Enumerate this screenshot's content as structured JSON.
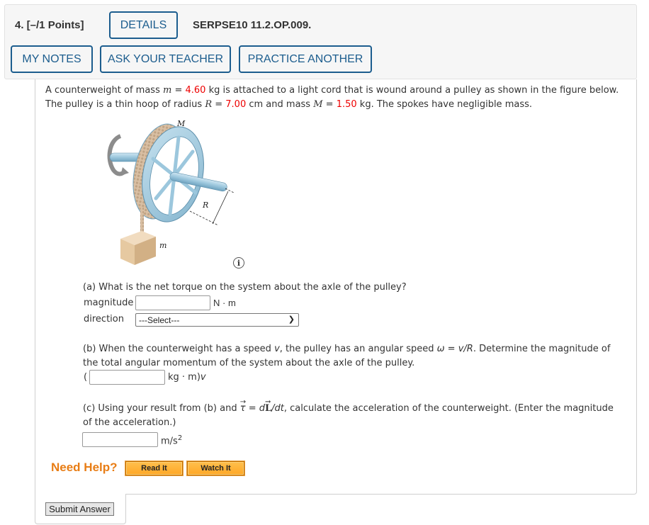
{
  "header": {
    "question_title": "4.  [–/1 Points]",
    "details_label": "DETAILS",
    "question_code": "SERPSE10 11.2.OP.009.",
    "my_notes_label": "MY NOTES",
    "ask_teacher_label": "ASK YOUR TEACHER",
    "practice_another_label": "PRACTICE ANOTHER"
  },
  "problem": {
    "line1_a": "A counterweight of mass ",
    "line1_var_m": "m",
    "line1_eq": " = ",
    "mass_m": "4.60",
    "line1_b": " kg is attached to a light cord that is wound around a pulley as shown in the figure below.",
    "line2_a": "The pulley is a thin hoop of radius ",
    "line2_var_R": "R",
    "line2_eq": " = ",
    "radius_R": "7.00",
    "line2_b": " cm and mass ",
    "line2_var_M": "M",
    "line2_eq2": " = ",
    "mass_M": "1.50",
    "line2_c": " kg. The spokes have negligible mass.",
    "value_color": "#ee0000"
  },
  "figure": {
    "label_M": "M",
    "label_R": "R",
    "label_m": "m",
    "info_icon": "info-icon",
    "info_glyph": "i"
  },
  "part_a": {
    "question": "(a) What is the net torque on the system about the axle of the pulley?",
    "magnitude_label": "magnitude",
    "magnitude_value": "",
    "magnitude_unit": "N · m",
    "direction_label": "direction",
    "direction_selected": "---Select---"
  },
  "part_b": {
    "line1_a": "(b) When the counterweight has a speed ",
    "v": "v",
    "line1_b": ", the pulley has an angular speed ",
    "omega": "ω",
    "line1_c": " = ",
    "v_over_R": "v/R",
    "line1_d": ". Determine the magnitude of",
    "line2": "the total angular momentum of the system about the axle of the pulley.",
    "open_paren": "(",
    "answer_value": "",
    "unit": "kg · m)",
    "unit_v": "v"
  },
  "part_c": {
    "line1_a": "(c) Using your result from (b) and ",
    "tau": "τ",
    "eq": " = ",
    "d": "d",
    "L": "L",
    "dt": "/dt",
    "line1_b": ", calculate the acceleration of the counterweight. (Enter the magnitude",
    "line2": "of the acceleration.)",
    "answer_value": "",
    "unit": "m/s",
    "unit_sup": "2"
  },
  "help": {
    "need_help_label": "Need Help?",
    "read_it_label": "Read It",
    "watch_it_label": "Watch It",
    "accent_color": "#e87d15"
  },
  "submit": {
    "label": "Submit Answer"
  }
}
